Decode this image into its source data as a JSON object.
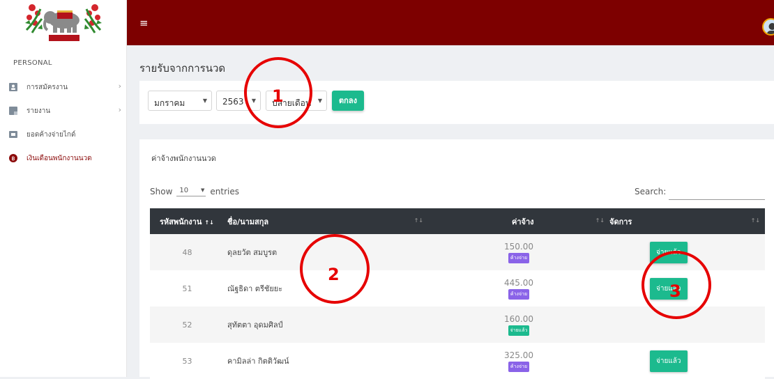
{
  "colors": {
    "topbar": "#7d0000",
    "primary_button": "#1cba8e",
    "badge_unpaid": "#8a63e8",
    "badge_paid": "#1cba8e",
    "annotation": "#e60000"
  },
  "sidebar": {
    "section_label": "PERSONAL",
    "items": [
      {
        "label": "การสมัครงาน",
        "icon": "user-card-icon"
      },
      {
        "label": "รายงาน",
        "icon": "report-icon"
      },
      {
        "label": "ยอดค้างจ่ายไกด์",
        "icon": "wallet-icon"
      },
      {
        "label": "เงินเดือนพนักงานนวด",
        "icon": "baht-coin-icon"
      }
    ]
  },
  "page_title": "รายรับจากการนวด",
  "filters": {
    "month": "มกราคม",
    "year": "2563",
    "period": "ปลายเดือน",
    "submit_label": "ตกลง"
  },
  "table_card": {
    "title": "ค่าจ้างพนักงานนวด",
    "show_label": "Show",
    "page_length": "10",
    "entries_label": "entries",
    "search_label": "Search:",
    "columns": [
      "รหัสพนักงาน",
      "ชื่อ/นามสกุล",
      "ค่าจ้าง",
      "จัดการ"
    ],
    "rows": [
      {
        "id": "48",
        "name": "ดุลยวัต สมบูรต",
        "amount": "150.00",
        "status": "ค้างจ่าย",
        "action": "จ่ายแล้ว"
      },
      {
        "id": "51",
        "name": "ณัฐธิดา ตรีชัยยะ",
        "amount": "445.00",
        "status": "ค้างจ่าย",
        "action": "จ่ายแล้ว"
      },
      {
        "id": "52",
        "name": "สุทัตตา อุดมศิลป์",
        "amount": "160.00",
        "status": "จ่ายแล้ว",
        "action": ""
      },
      {
        "id": "53",
        "name": "คามิลล่า กิตติวัฒน์",
        "amount": "325.00",
        "status": "ค้างจ่าย",
        "action": "จ่ายแล้ว"
      }
    ]
  },
  "annotations": [
    "1",
    "2",
    "3"
  ]
}
